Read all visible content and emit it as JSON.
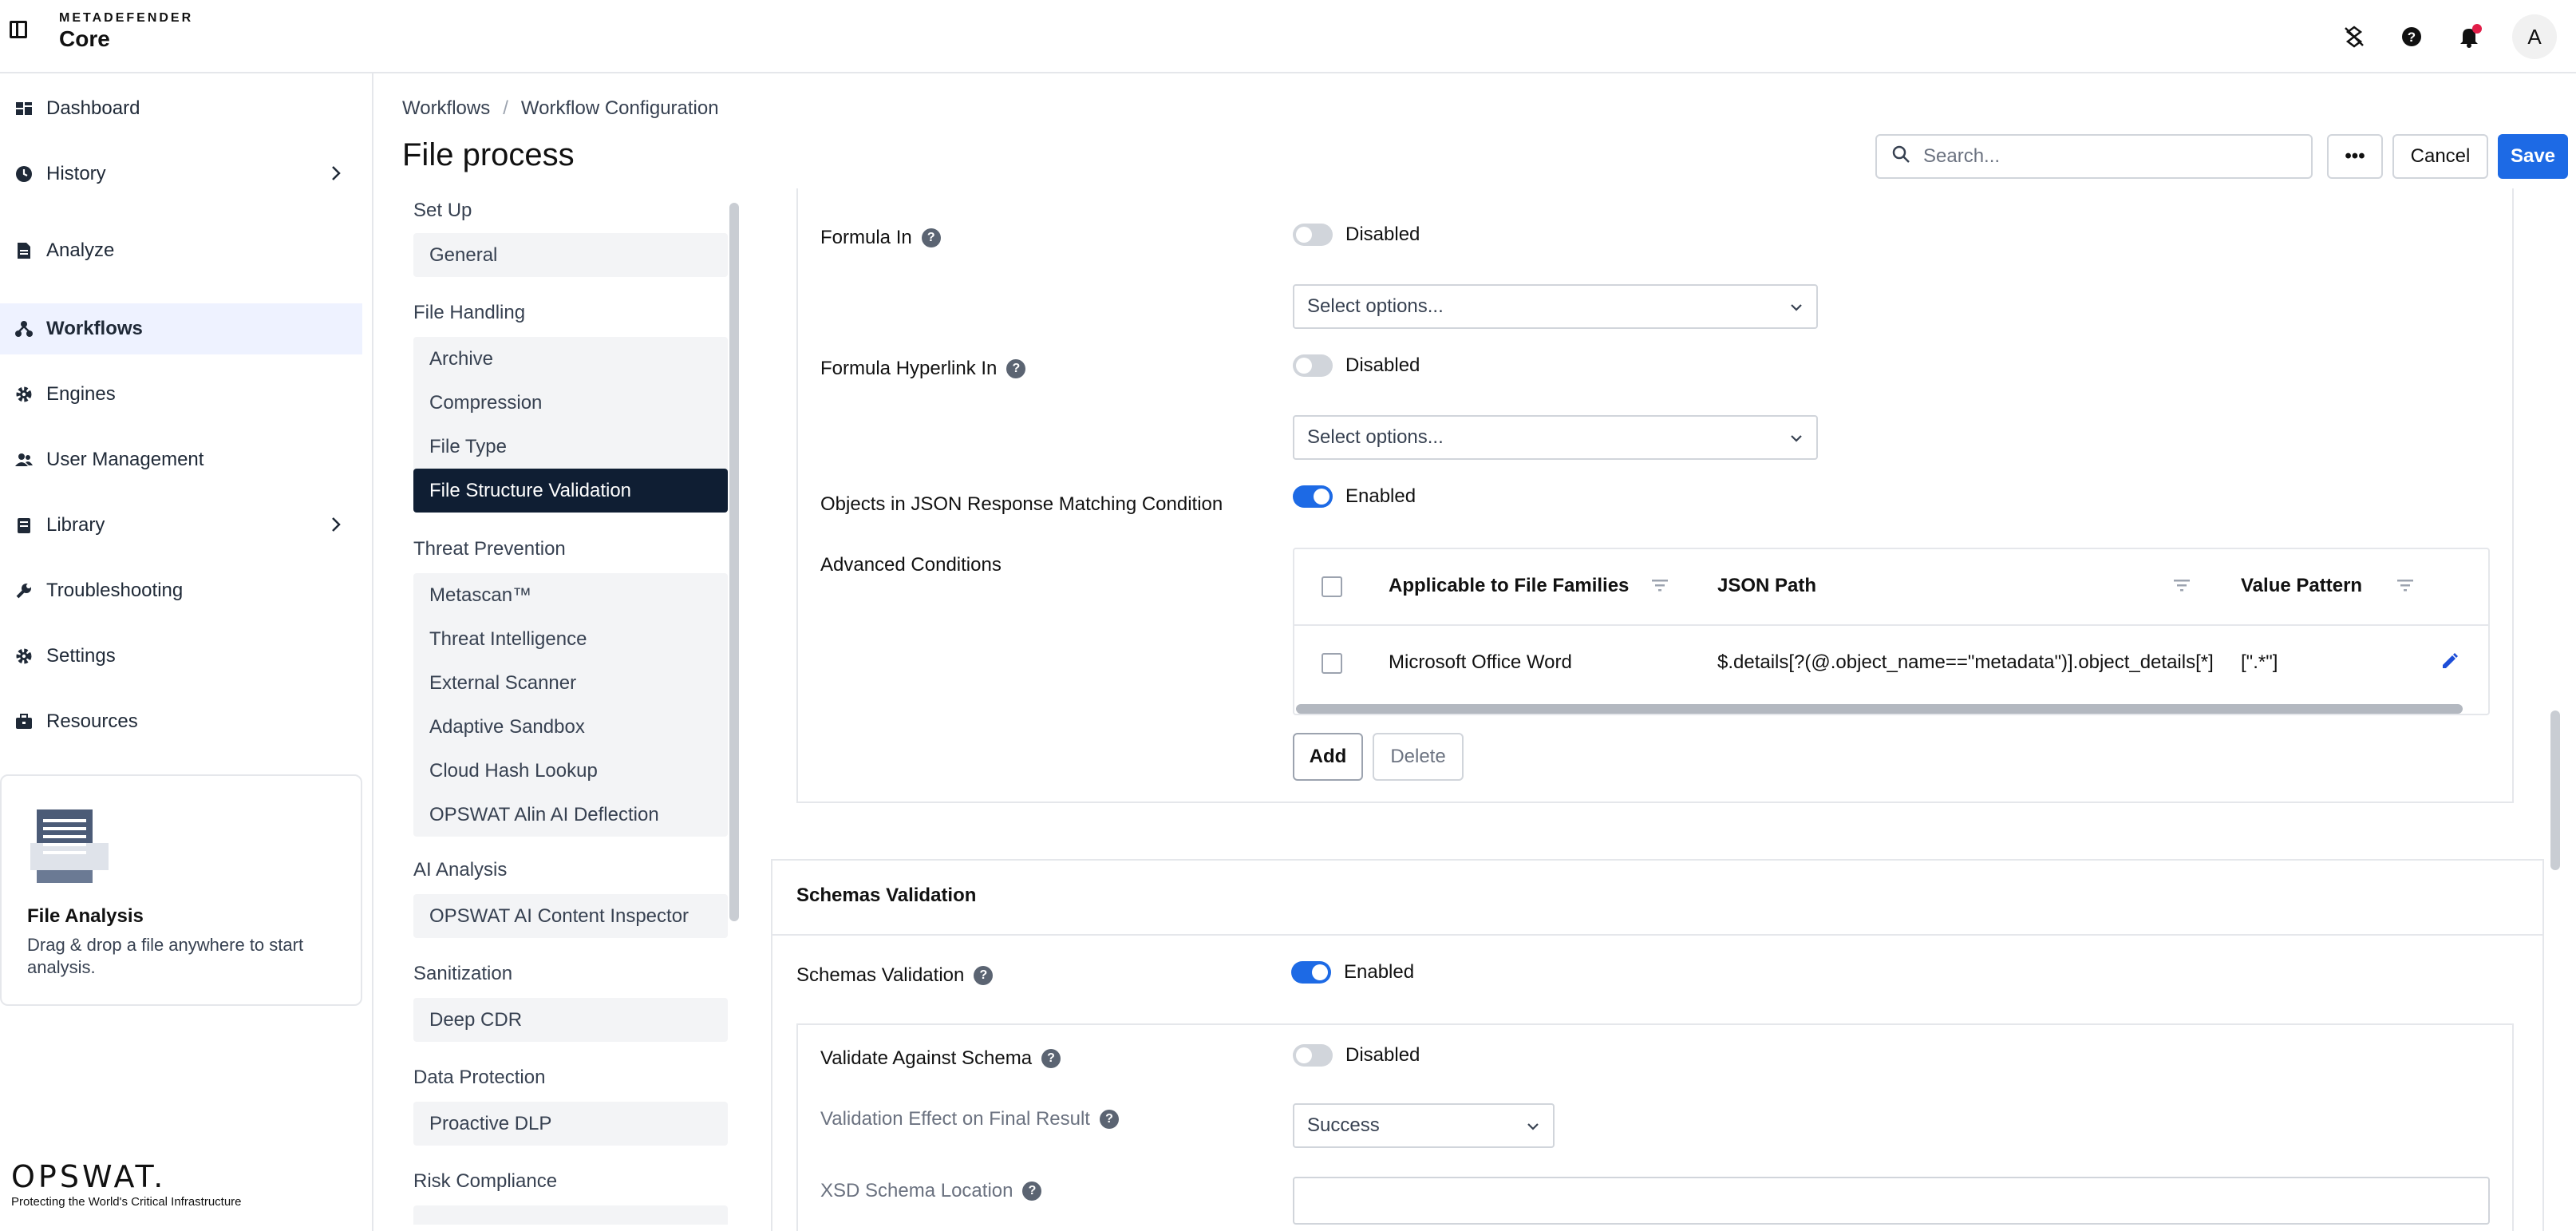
{
  "topbar": {
    "brand_small": "METADEFENDER",
    "brand_main": "Core",
    "avatar_initial": "A",
    "icons": [
      "collapse-sidebar-icon",
      "no-connection-icon",
      "help-icon",
      "notifications-icon"
    ]
  },
  "sidebar": {
    "items": [
      {
        "label": "Dashboard",
        "icon": "dashboard-icon"
      },
      {
        "label": "History",
        "icon": "history-icon"
      },
      {
        "label": "Analyze",
        "icon": "analyze-icon"
      },
      {
        "label": "Workflows",
        "icon": "workflows-icon",
        "active": true
      },
      {
        "label": "Engines",
        "icon": "gear-icon"
      },
      {
        "label": "User Management",
        "icon": "users-icon"
      },
      {
        "label": "Library",
        "icon": "library-icon"
      },
      {
        "label": "Troubleshooting",
        "icon": "wrench-icon"
      },
      {
        "label": "Settings",
        "icon": "gear-icon"
      },
      {
        "label": "Resources",
        "icon": "resources-icon"
      }
    ],
    "file_card": {
      "title": "File Analysis",
      "description": "Drag & drop a file anywhere to start analysis."
    },
    "footer": {
      "logo": "OPSWAT.",
      "tagline": "Protecting the World's Critical Infrastructure"
    }
  },
  "header": {
    "breadcrumb": [
      "Workflows",
      "Workflow Configuration"
    ],
    "breadcrumb_sep": "/",
    "title": "File process",
    "search_placeholder": "Search...",
    "more_label": "•••",
    "cancel_label": "Cancel",
    "save_label": "Save"
  },
  "settings_nav": {
    "groups": [
      {
        "label": "Set Up",
        "items": [
          "General"
        ]
      },
      {
        "label": "File Handling",
        "items": [
          "Archive",
          "Compression",
          "File Type",
          "File Structure Validation"
        ]
      },
      {
        "label": "Threat Prevention",
        "items": [
          "Metascan™",
          "Threat Intelligence",
          "External Scanner",
          "Adaptive Sandbox",
          "Cloud Hash Lookup",
          "OPSWAT Alin AI Deflection"
        ]
      },
      {
        "label": "AI Analysis",
        "items": [
          "OPSWAT AI Content Inspector"
        ]
      },
      {
        "label": "Sanitization",
        "items": [
          "Deep CDR"
        ]
      },
      {
        "label": "Data Protection",
        "items": [
          "Proactive DLP"
        ]
      },
      {
        "label": "Risk Compliance",
        "items": []
      }
    ],
    "active_item": "File Structure Validation"
  },
  "content": {
    "formula_in": {
      "label": "Formula In",
      "state": "Disabled",
      "select_placeholder": "Select options..."
    },
    "formula_hyperlink_in": {
      "label": "Formula Hyperlink In",
      "state": "Disabled",
      "select_placeholder": "Select options..."
    },
    "objects_json": {
      "label": "Objects in JSON Response Matching Condition",
      "state": "Enabled"
    },
    "advanced_conditions": {
      "label": "Advanced Conditions",
      "columns": [
        "Applicable to File Families",
        "JSON Path",
        "Value Pattern"
      ],
      "rows": [
        {
          "family": "Microsoft Office Word",
          "json_path": "$.details[?(@.object_name==\"metadata\")].object_details[*]",
          "value_pattern": "[\".*\"]"
        }
      ],
      "add_label": "Add",
      "delete_label": "Delete"
    },
    "schemas_section": {
      "title": "Schemas Validation",
      "schemas_validation": {
        "label": "Schemas Validation",
        "state": "Enabled"
      },
      "validate_against_schema": {
        "label": "Validate Against Schema",
        "state": "Disabled"
      },
      "validation_effect": {
        "label": "Validation Effect on Final Result",
        "value": "Success"
      },
      "xsd_location": {
        "label": "XSD Schema Location",
        "value": ""
      }
    }
  }
}
